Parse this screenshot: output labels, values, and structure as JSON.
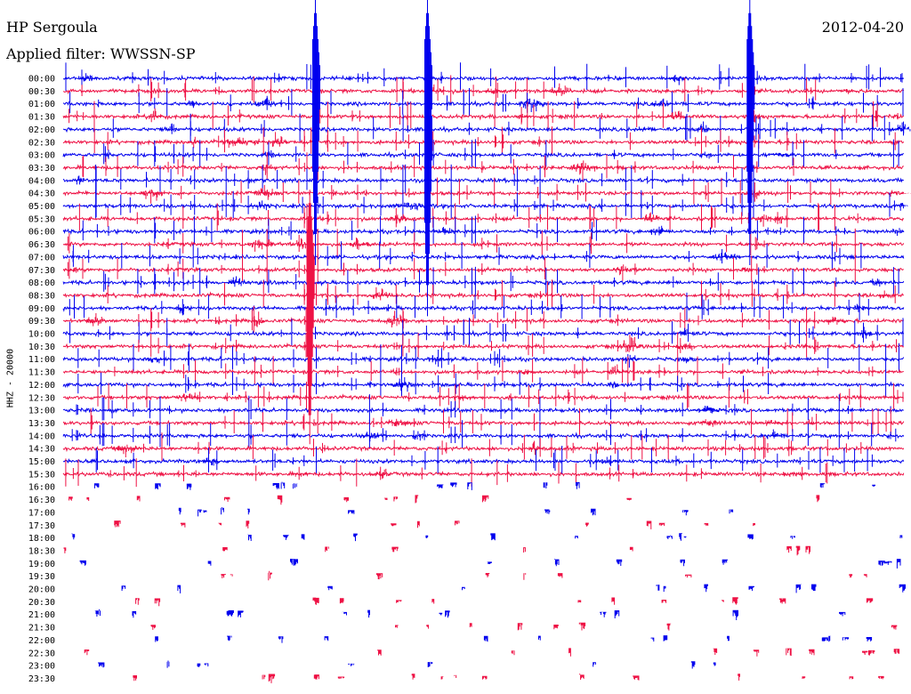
{
  "header": {
    "station": "HP Sergoula",
    "date": "2012-04-20",
    "filter": "Applied filter: WWSSN-SP"
  },
  "chart_data": {
    "type": "helicorder",
    "title": "HP Sergoula",
    "date": "2012-04-20",
    "filter": "WWSSN-SP",
    "ylabel": "HHZ - 20000",
    "row_labels": [
      "00:00",
      "00:30",
      "01:00",
      "01:30",
      "02:00",
      "02:30",
      "03:00",
      "03:30",
      "04:00",
      "04:30",
      "05:00",
      "05:30",
      "06:00",
      "06:30",
      "07:00",
      "07:30",
      "08:00",
      "08:30",
      "09:00",
      "09:30",
      "10:00",
      "10:30",
      "11:00",
      "11:30",
      "12:00",
      "12:30",
      "13:00",
      "13:30",
      "14:00",
      "14:30",
      "15:00",
      "15:30",
      "16:00",
      "16:30",
      "17:00",
      "17:30",
      "18:00",
      "18:30",
      "19:00",
      "19:30",
      "20:00",
      "20:30",
      "21:00",
      "21:30",
      "22:00",
      "22:30",
      "23:00",
      "23:30"
    ],
    "trace_colors": [
      "#0000ee",
      "#ee1144"
    ],
    "continuous_until_row": 32,
    "large_events": [
      {
        "row": 0,
        "minute": 9.0
      },
      {
        "row": 0,
        "minute": 13.0
      },
      {
        "row": 0,
        "minute": 24.5
      },
      {
        "row": 4,
        "minute": 13.0
      },
      {
        "row": 15,
        "minute": 8.8
      }
    ]
  },
  "colors": {
    "background": "#ffffff",
    "text": "#000000",
    "blue_trace": "#0000ee",
    "red_trace": "#ee1144"
  }
}
